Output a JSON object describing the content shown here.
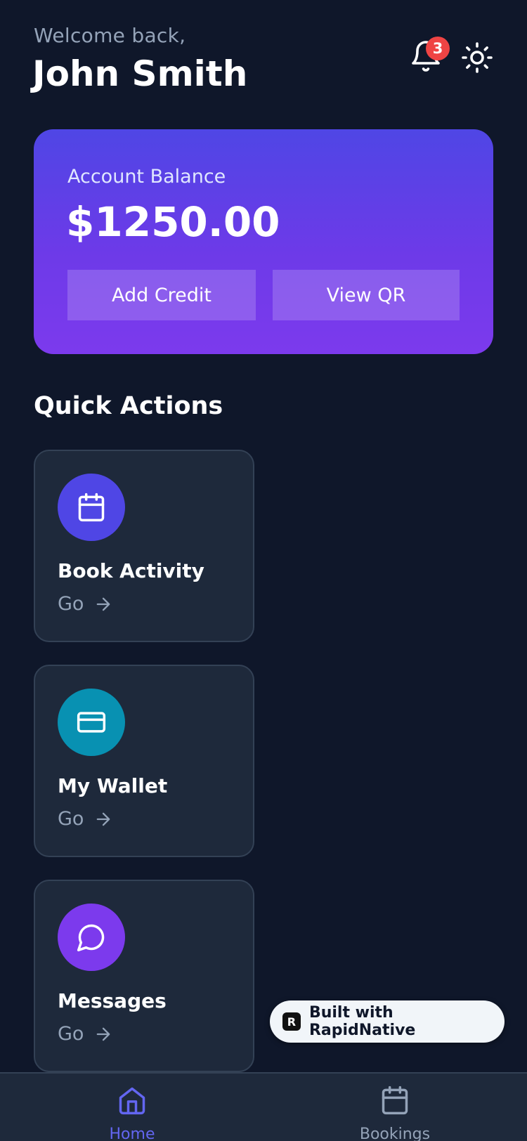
{
  "header": {
    "welcome": "Welcome back,",
    "user_name": "John Smith",
    "notification_count": "3"
  },
  "balance": {
    "label": "Account Balance",
    "value": "$1250.00",
    "add_credit_label": "Add Credit",
    "view_qr_label": "View QR"
  },
  "quick_actions": {
    "title": "Quick Actions",
    "items": [
      {
        "title": "Book Activity",
        "go": "Go",
        "icon": "calendar-icon",
        "color": "#4f46e5"
      },
      {
        "title": "My Wallet",
        "go": "Go",
        "icon": "credit-card-icon",
        "color": "#0891b2"
      },
      {
        "title": "Messages",
        "go": "Go",
        "icon": "message-circle-icon",
        "color": "#7c3aed"
      }
    ]
  },
  "built_with": "Built with RapidNative",
  "tabs": [
    {
      "label": "Home",
      "icon": "home-icon",
      "active": true
    },
    {
      "label": "Bookings",
      "icon": "calendar-icon",
      "active": false
    }
  ],
  "colors": {
    "background": "#0f172a",
    "card": "#1e293b",
    "accent": "#6366f1",
    "badge": "#ef4444"
  }
}
